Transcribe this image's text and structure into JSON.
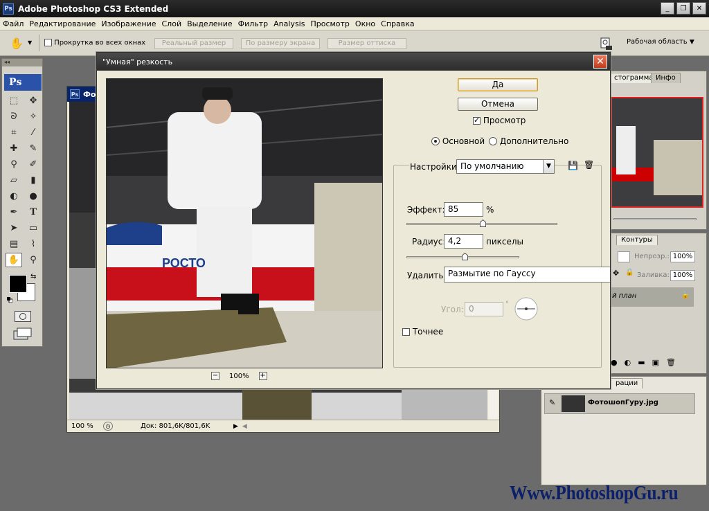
{
  "app": {
    "title": "Adobe Photoshop CS3 Extended",
    "logo": "Ps",
    "window_buttons": [
      "_",
      "❐",
      "✕"
    ]
  },
  "menu": [
    "Файл",
    "Редактирование",
    "Изображение",
    "Слой",
    "Выделение",
    "Фильтр",
    "Analysis",
    "Просмотр",
    "Окно",
    "Справка"
  ],
  "options_bar": {
    "scroll_all_label": "Прокрутка во всех окнах",
    "actual_pixels": "Реальный размер",
    "fit_screen": "По размеру экрана",
    "print_size": "Размер оттиска",
    "workspace": "Рабочая область"
  },
  "toolbox": {
    "logo": "Ps"
  },
  "document": {
    "title": "Фото",
    "zoom": "100 %",
    "doc_info": "Док: 801,6K/801,6K"
  },
  "panels": {
    "navigator_tabs": [
      "стограмма",
      "Инфо"
    ],
    "layers_tabs": [
      "Контуры"
    ],
    "opacity_label": "Непрозр.:",
    "opacity_value": "100%",
    "fill_label": "Заливка:",
    "fill_value": "100%",
    "layer_name": "й план",
    "history_tab": "рации",
    "history_item": "ФотошопГуру.jpg"
  },
  "dialog": {
    "title": "\"Умная\" резкость",
    "ok": "Да",
    "cancel": "Отмена",
    "preview_label": "Просмотр",
    "mode_basic": "Основной",
    "mode_advanced": "Дополнительно",
    "settings_label": "Настройки:",
    "settings_value": "По умолчанию",
    "amount_label": "Эффект:",
    "amount_value": "85",
    "amount_unit": "%",
    "amount_level": 85,
    "radius_label": "Радиус:",
    "radius_value": "4,2",
    "radius_unit": "пикселы",
    "remove_label": "Удалить:",
    "remove_value": "Размытие по Гауссу",
    "angle_label": "Угол:",
    "angle_value": "0",
    "angle_unit": "°",
    "more_accurate": "Точнее",
    "zoom_value": "100%",
    "zoom_minus": "−",
    "zoom_plus": "+"
  },
  "photo": {
    "plane_text": "РОСТО"
  },
  "watermark": "Www.PhotoshopGu.ru"
}
